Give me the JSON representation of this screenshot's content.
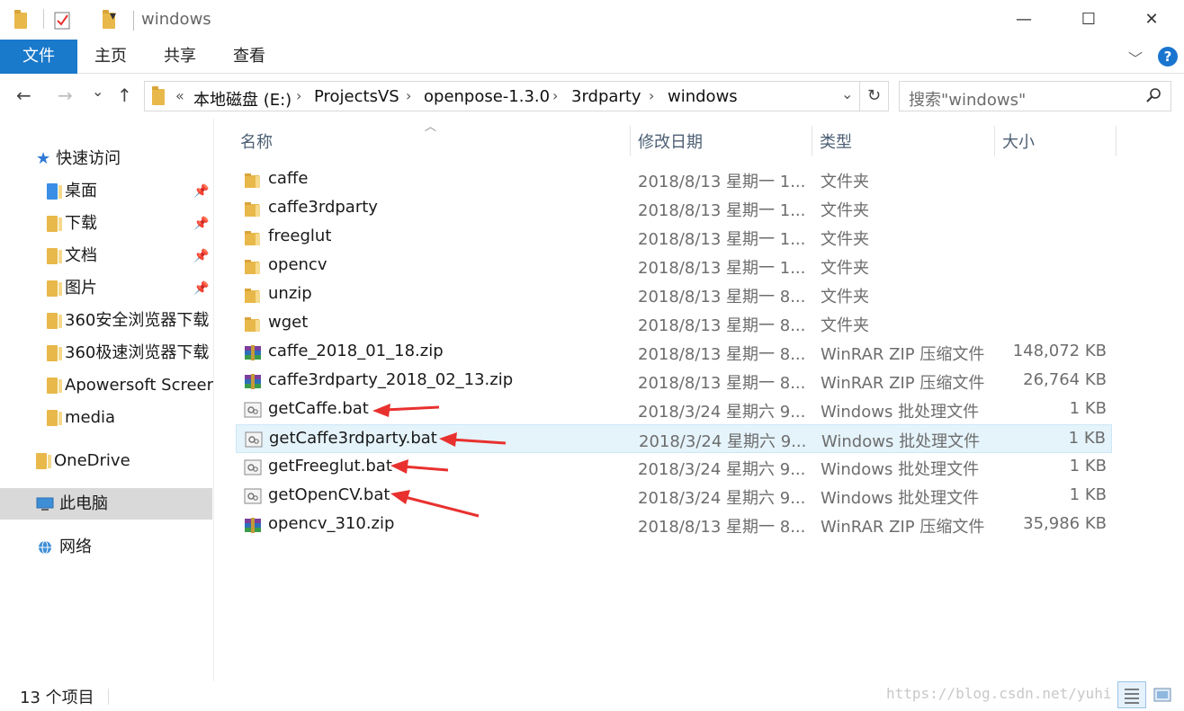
{
  "window": {
    "title": "windows",
    "minimize": "—",
    "maximize": "☐",
    "close": "✕"
  },
  "ribbon": {
    "tabs": [
      "文件",
      "主页",
      "共享",
      "查看"
    ],
    "help": "?"
  },
  "nav": {
    "back": "←",
    "forward": "→",
    "recent": "⌄",
    "up": "↑",
    "breadcrumb_overflow": "«",
    "path": [
      "本地磁盘 (E:)",
      "ProjectsVS",
      "openpose-1.3.0",
      "3rdparty",
      "windows"
    ],
    "refresh": "↻",
    "search_placeholder": "搜索\"windows\""
  },
  "sidebar": {
    "quick_access": "快速访问",
    "pinned": [
      {
        "label": "桌面",
        "icon": "desktop-folder-icon"
      },
      {
        "label": "下载",
        "icon": "downloads-folder-icon"
      },
      {
        "label": "文档",
        "icon": "documents-folder-icon"
      },
      {
        "label": "图片",
        "icon": "pictures-folder-icon"
      }
    ],
    "folders": [
      "360安全浏览器下载",
      "360极速浏览器下载",
      "Apowersoft Screer",
      "media"
    ],
    "onedrive": "OneDrive",
    "this_pc": "此电脑",
    "network": "网络"
  },
  "columns": {
    "name": "名称",
    "date": "修改日期",
    "type": "类型",
    "size": "大小"
  },
  "files": [
    {
      "name": "caffe",
      "date": "2018/8/13 星期一 1...",
      "type": "文件夹",
      "size": "",
      "icon": "folder-icon"
    },
    {
      "name": "caffe3rdparty",
      "date": "2018/8/13 星期一 1...",
      "type": "文件夹",
      "size": "",
      "icon": "folder-icon"
    },
    {
      "name": "freeglut",
      "date": "2018/8/13 星期一 1...",
      "type": "文件夹",
      "size": "",
      "icon": "folder-icon"
    },
    {
      "name": "opencv",
      "date": "2018/8/13 星期一 1...",
      "type": "文件夹",
      "size": "",
      "icon": "folder-icon"
    },
    {
      "name": "unzip",
      "date": "2018/8/13 星期一 8...",
      "type": "文件夹",
      "size": "",
      "icon": "folder-icon"
    },
    {
      "name": "wget",
      "date": "2018/8/13 星期一 8...",
      "type": "文件夹",
      "size": "",
      "icon": "folder-icon"
    },
    {
      "name": "caffe_2018_01_18.zip",
      "date": "2018/8/13 星期一 8...",
      "type": "WinRAR ZIP 压缩文件",
      "size": "148,072 KB",
      "icon": "winrar-archive-icon"
    },
    {
      "name": "caffe3rdparty_2018_02_13.zip",
      "date": "2018/8/13 星期一 8...",
      "type": "WinRAR ZIP 压缩文件",
      "size": "26,764 KB",
      "icon": "winrar-archive-icon"
    },
    {
      "name": "getCaffe.bat",
      "date": "2018/3/24 星期六 9...",
      "type": "Windows 批处理文件",
      "size": "1 KB",
      "icon": "batch-file-icon"
    },
    {
      "name": "getCaffe3rdparty.bat",
      "date": "2018/3/24 星期六 9...",
      "type": "Windows 批处理文件",
      "size": "1 KB",
      "icon": "batch-file-icon"
    },
    {
      "name": "getFreeglut.bat",
      "date": "2018/3/24 星期六 9...",
      "type": "Windows 批处理文件",
      "size": "1 KB",
      "icon": "batch-file-icon"
    },
    {
      "name": "getOpenCV.bat",
      "date": "2018/3/24 星期六 9...",
      "type": "Windows 批处理文件",
      "size": "1 KB",
      "icon": "batch-file-icon"
    },
    {
      "name": "opencv_310.zip",
      "date": "2018/8/13 星期一 8...",
      "type": "WinRAR ZIP 压缩文件",
      "size": "35,986 KB",
      "icon": "winrar-archive-icon"
    }
  ],
  "selected_row": "getCaffe3rdparty.bat",
  "status": {
    "count": "13 个项目",
    "watermark": "https://blog.csdn.net/yuhi"
  },
  "colors": {
    "accent": "#1979ca",
    "annotation_arrow": "#e8312f",
    "selection": "#e5f3fb"
  }
}
